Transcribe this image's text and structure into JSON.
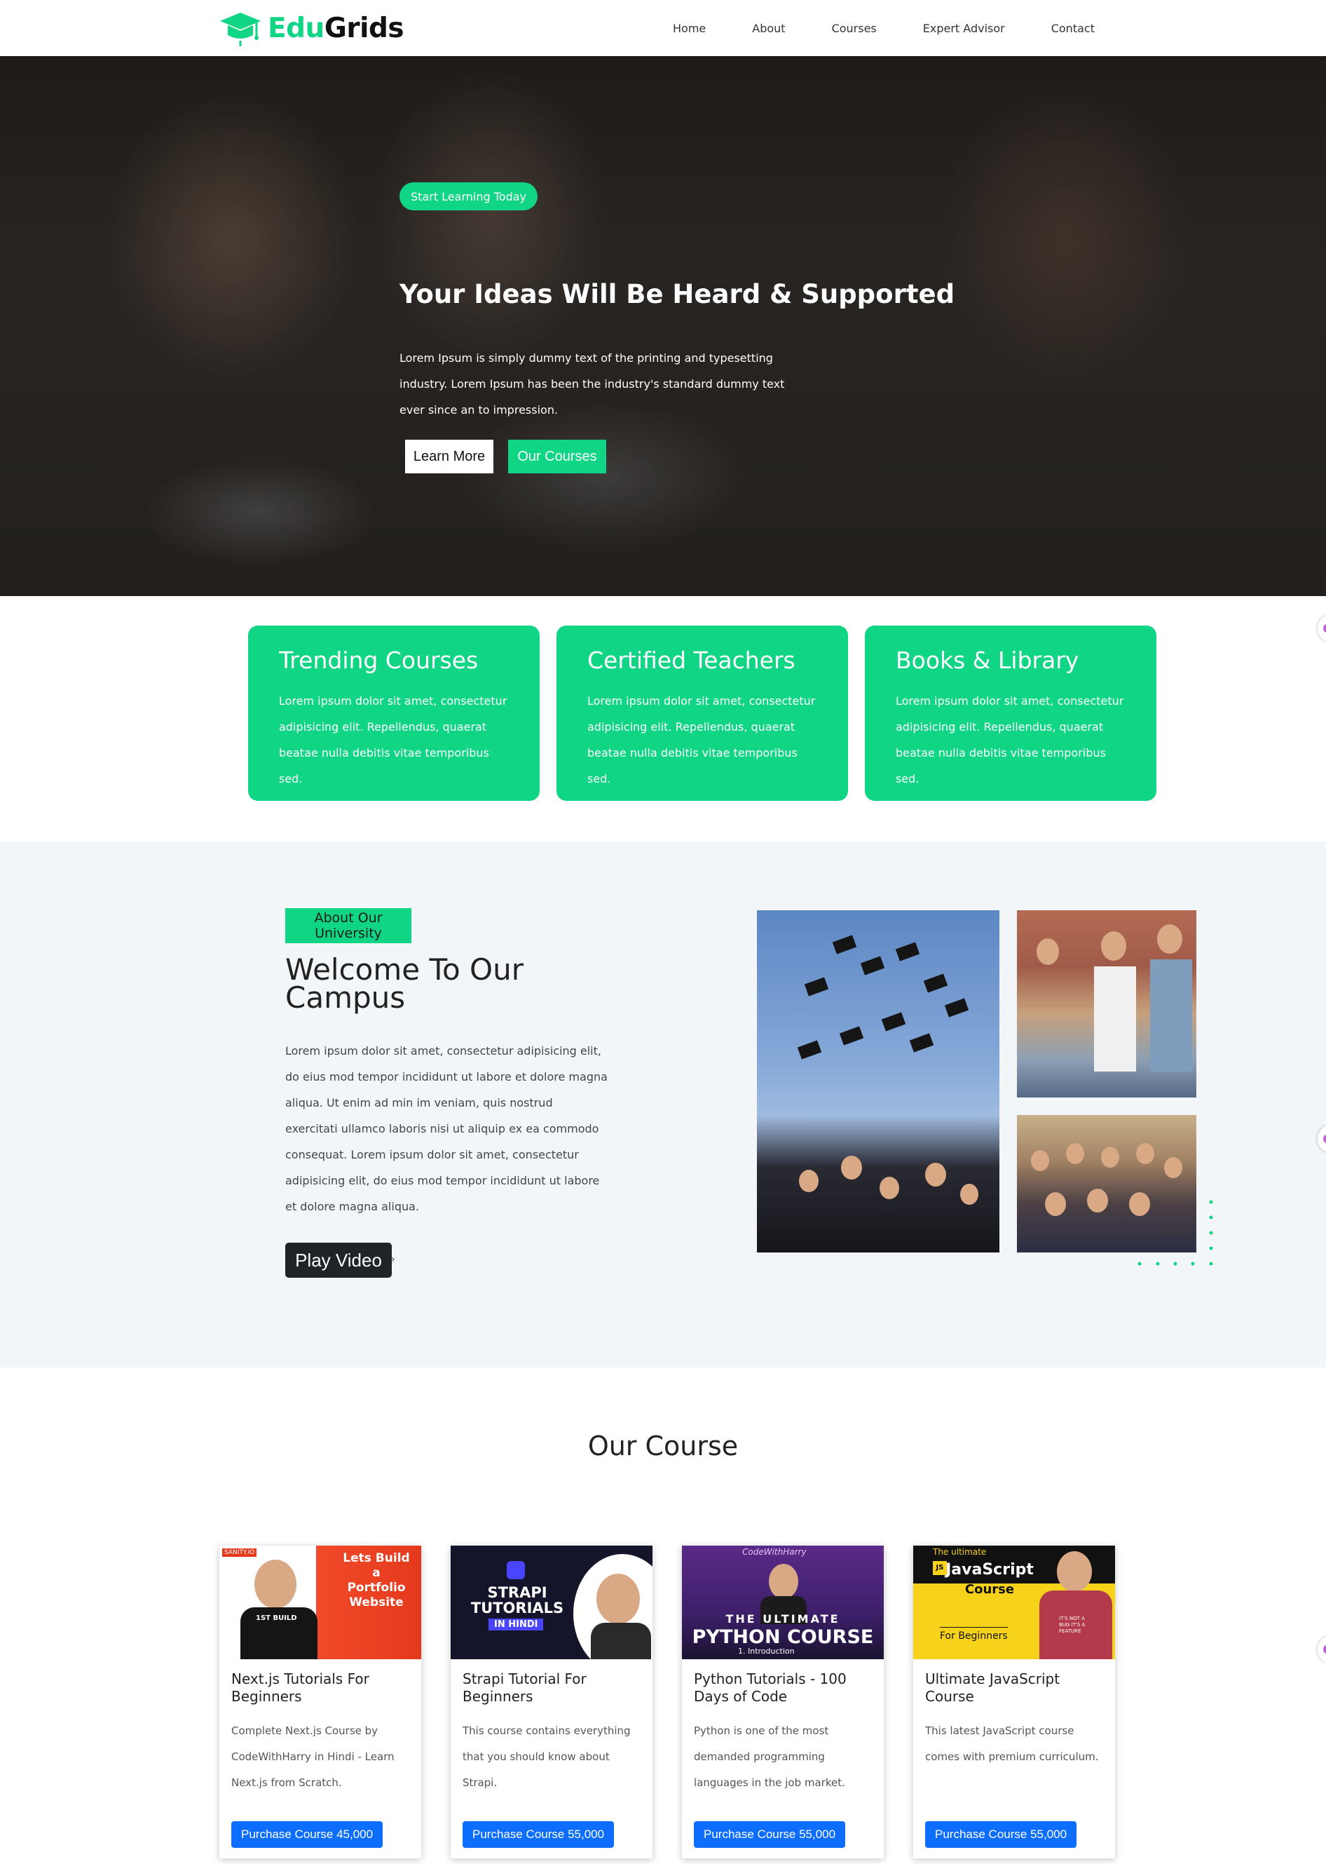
{
  "brand": {
    "part1": "Edu",
    "part2": "Grids",
    "accent": "#10d585"
  },
  "nav": {
    "links": [
      "Home",
      "About",
      "Courses",
      "Expert Advisor",
      "Contact"
    ]
  },
  "hero": {
    "badge": "Start Learning Today",
    "title": "Your Ideas Will Be Heard & Supported",
    "text": "Lorem Ipsum is simply dummy text of the printing and typesetting industry. Lorem Ipsum has been the industry's standard dummy text ever since an to impression.",
    "learn_more": "Learn More",
    "our_courses": "Our Courses"
  },
  "features": [
    {
      "title": "Trending Courses",
      "text": "Lorem ipsum dolor sit amet, consectetur adipisicing elit. Repellendus, quaerat beatae nulla debitis vitae temporibus sed."
    },
    {
      "title": "Certified Teachers",
      "text": "Lorem ipsum dolor sit amet, consectetur adipisicing elit. Repellendus, quaerat beatae nulla debitis vitae temporibus sed."
    },
    {
      "title": "Books & Library",
      "text": "Lorem ipsum dolor sit amet, consectetur adipisicing elit. Repellendus, quaerat beatae nulla debitis vitae temporibus sed."
    }
  ],
  "about": {
    "badge": "About Our University",
    "title": "Welcome To Our Campus",
    "text": "Lorem ipsum dolor sit amet, consectetur adipisicing elit, do eius mod tempor incididunt ut labore et dolore magna aliqua. Ut enim ad min im veniam, quis nostrud exercitati ullamco laboris nisi ut aliquip ex ea commodo consequat. Lorem ipsum dolor sit amet, consectetur adipisicing elit, do eius mod tempor incididunt ut labore et dolore magna aliqua.",
    "play_video": "Play Video",
    "play_arrow": "›"
  },
  "courses_section": {
    "heading": "Our Course",
    "cards": [
      {
        "title": "Next.js Tutorials For Beginners",
        "desc": "Complete Next.js Course by CodeWithHarry in Hindi - Learn Next.js from Scratch.",
        "button": "Purchase Course 45,000",
        "thumb_lines": [
          "Lets Build",
          "a",
          "Portfolio",
          "Website"
        ],
        "thumb_tag": "SANITY.IO",
        "thumb_shirt": "1ST BUILD"
      },
      {
        "title": "Strapi Tutorial For Beginners",
        "desc": "This course contains everything that you should know about Strapi.",
        "button": "Purchase Course 55,000",
        "thumb_lines": [
          "STRAPI",
          "TUTORIALS"
        ],
        "thumb_tag": "IN HINDI"
      },
      {
        "title": "Python Tutorials - 100 Days of Code",
        "desc": "Python is one of the most demanded programming languages in the job market.",
        "button": "Purchase Course 55,000",
        "thumb_lines": [
          "THE ULTIMATE",
          "PYTHON COURSE"
        ],
        "thumb_tag": "1. Introduction",
        "thumb_top": "CodeWithHarry"
      },
      {
        "title": "Ultimate JavaScript Course",
        "desc": "This latest JavaScript course comes with premium curriculum.",
        "button": "Purchase Course 55,000",
        "thumb_lines": [
          "The ultimate",
          "JavaScript",
          "Course"
        ],
        "thumb_tag": "For Beginners",
        "thumb_badge": "JS",
        "thumb_shirt": "IT'S NOT A BUG IT'S A FEATURE"
      }
    ]
  },
  "icons": {
    "logo": "graduation-cap-icon",
    "side_widget": "widget-icon"
  }
}
